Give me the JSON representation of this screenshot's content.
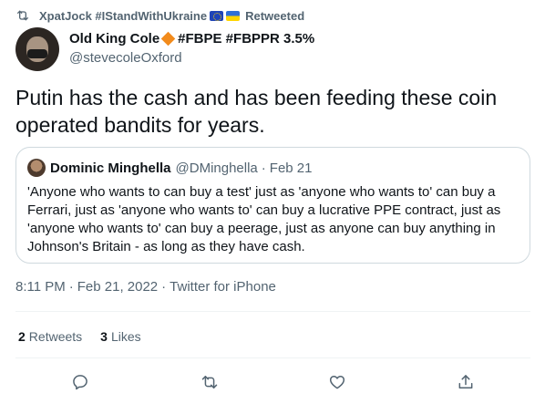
{
  "retweeted_by": {
    "name": "XpatJock #IStandWithUkraine",
    "label": "Retweeted",
    "flag_icons": [
      "eu-flag-icon",
      "ukraine-flag-icon"
    ]
  },
  "tweet": {
    "author_name": "Old King Cole",
    "author_name_suffix": "#FBPE #FBPPR 3.5%",
    "author_handle": "@stevecoleOxford",
    "text": "Putin has the cash and has been feeding these coin operated bandits for years.",
    "time": "8:11 PM",
    "date": "Feb 21, 2022",
    "source": "Twitter for iPhone",
    "separator": "·"
  },
  "quoted_tweet": {
    "author_name": "Dominic Minghella",
    "author_handle": "@DMinghella",
    "separator": "·",
    "date": "Feb 21",
    "text": "'Anyone who wants to can buy a test' just as 'anyone who wants to' can buy a Ferrari, just as 'anyone who wants to' can buy a lucrative PPE contract, just as 'anyone who wants to' can buy a peerage, just as anyone can buy anything in Johnson's Britain - as long as they have cash."
  },
  "stats": {
    "retweets_count": "2",
    "retweets_label": "Retweets",
    "likes_count": "3",
    "likes_label": "Likes"
  },
  "actions": [
    "reply-icon",
    "retweet-icon",
    "like-icon",
    "share-icon"
  ],
  "colors": {
    "text_primary": "#0f1419",
    "text_secondary": "#536471",
    "border": "#cfd9de",
    "divider": "#eff3f4",
    "diamond": "#f28b1c"
  }
}
